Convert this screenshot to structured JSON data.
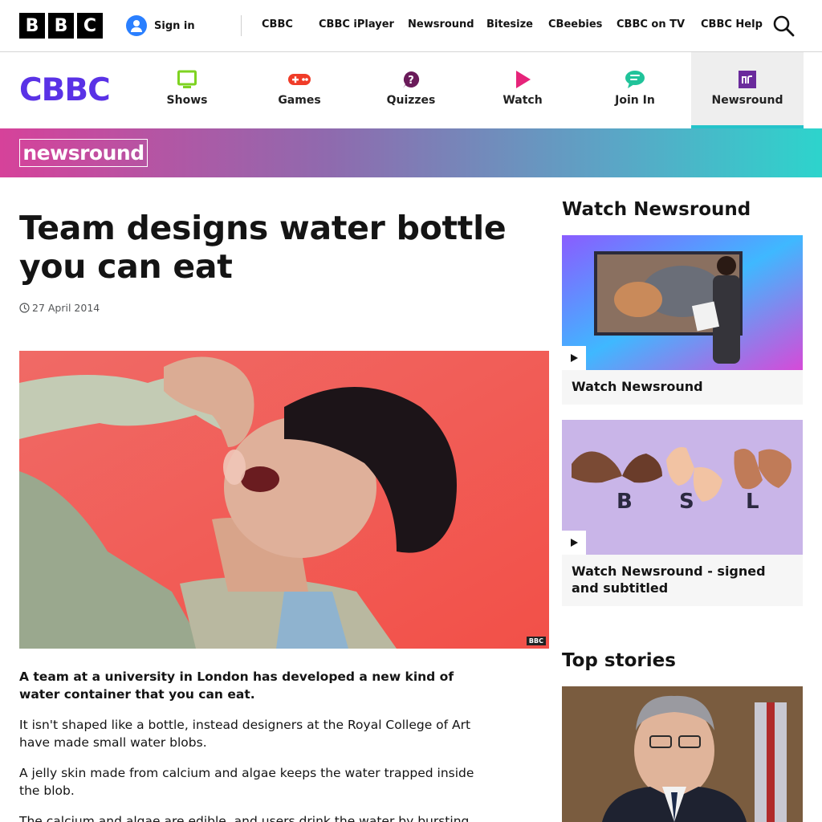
{
  "bbc": {
    "logo_letters": [
      "B",
      "B",
      "C"
    ],
    "signin_label": "Sign in",
    "links": [
      "CBBC",
      "CBBC iPlayer",
      "Newsround",
      "Bitesize",
      "CBeebies",
      "CBBC on TV",
      "CBBC Help"
    ]
  },
  "cbbc": {
    "logo": "CBBC",
    "nav": [
      {
        "label": "Shows",
        "icon": "tv-icon",
        "color": "#7ed321"
      },
      {
        "label": "Games",
        "icon": "gamepad-icon",
        "color": "#f03c28"
      },
      {
        "label": "Quizzes",
        "icon": "question-icon",
        "color": "#6a1b5a"
      },
      {
        "label": "Watch",
        "icon": "play-icon",
        "color": "#e6247a"
      },
      {
        "label": "Join In",
        "icon": "chat-icon",
        "color": "#20c39a"
      },
      {
        "label": "Newsround",
        "icon": "newsround-icon",
        "color": "#6a2a9c"
      }
    ],
    "active_nav": "Newsround",
    "accent": "#5a32e6"
  },
  "banner": {
    "logo": "newsround"
  },
  "article": {
    "headline": "Team designs water bottle you can eat",
    "date": "27 April 2014",
    "image_credit": "BBC",
    "intro": "A team at a university in London has developed a new kind of water container that you can eat.",
    "paragraphs": [
      "It isn't shaped like a bottle, instead designers at the Royal College of Art have made small water blobs.",
      "A jelly skin made from calcium and algae keeps the water trapped inside the blob.",
      "The calcium and algae are edible, and users drink the water by bursting the"
    ]
  },
  "sidebar": {
    "watch_heading": "Watch Newsround",
    "cards": [
      {
        "title": "Watch Newsround"
      },
      {
        "title": "Watch Newsround - signed and subtitled",
        "bsl_letters": [
          "B",
          "S",
          "L"
        ]
      }
    ],
    "top_stories_heading": "Top stories"
  }
}
